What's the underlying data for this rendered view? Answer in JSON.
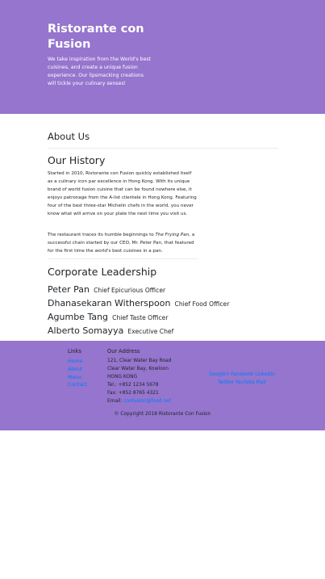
{
  "header": {
    "title": "Ristorante con Fusion",
    "tagline": "We take inspiration from the World's best cuisines, and create a unique fusion experience. Our lipsmacking creations will tickle your culinary senses!"
  },
  "about": {
    "title": "About Us"
  },
  "history": {
    "title": "Our History",
    "p1": "Started in 2010, Ristorante con Fusion quickly established itself as a culinary icon par excellence in Hong Kong. With its unique brand of world fusion cuisine that can be found nowhere else, it enjoys patronage from the A-list clientele in Hong Kong. Featuring four of the best three-star Michelin chefs in the world, you never know what will arrive on your plate the next time you visit us.",
    "p2_a": "The restaurant traces its humble beginnings to ",
    "p2_em": "The Frying Pan",
    "p2_b": ", a successful chain started by our CEO, Mr. Peter Pan, that featured for the first time the world's best cuisines in a pan."
  },
  "leadership": {
    "title": "Corporate Leadership",
    "people": [
      {
        "name": "Peter Pan",
        "role": "Chief Epicurious Officer"
      },
      {
        "name": "Dhanasekaran Witherspoon",
        "role": "Chief Food Officer"
      },
      {
        "name": "Agumbe Tang",
        "role": "Chief Taste Officer"
      },
      {
        "name": "Alberto Somayya",
        "role": "Executive Chef"
      }
    ]
  },
  "footer": {
    "links_title": "Links",
    "links": [
      "Home",
      "About",
      "Menu",
      "Contact"
    ],
    "address_title": "Our Address",
    "address": [
      "121, Clear Water Bay Road",
      "Clear Water Bay, Kowloon",
      "HONG KONG"
    ],
    "tel": "Tel.: +852 1234 5678",
    "fax": "Fax: +852 8765 4321",
    "email_label": "Email: ",
    "email": "confusion@food.net",
    "social_line1": "Google+ Facebook Linkedin",
    "social_line2": "Twitter YouTube Mail",
    "copyright": "© Copyright 2018 Ristorante Con Fusion"
  },
  "colors": {
    "brand": "#9575cd",
    "link": "#007bff"
  }
}
